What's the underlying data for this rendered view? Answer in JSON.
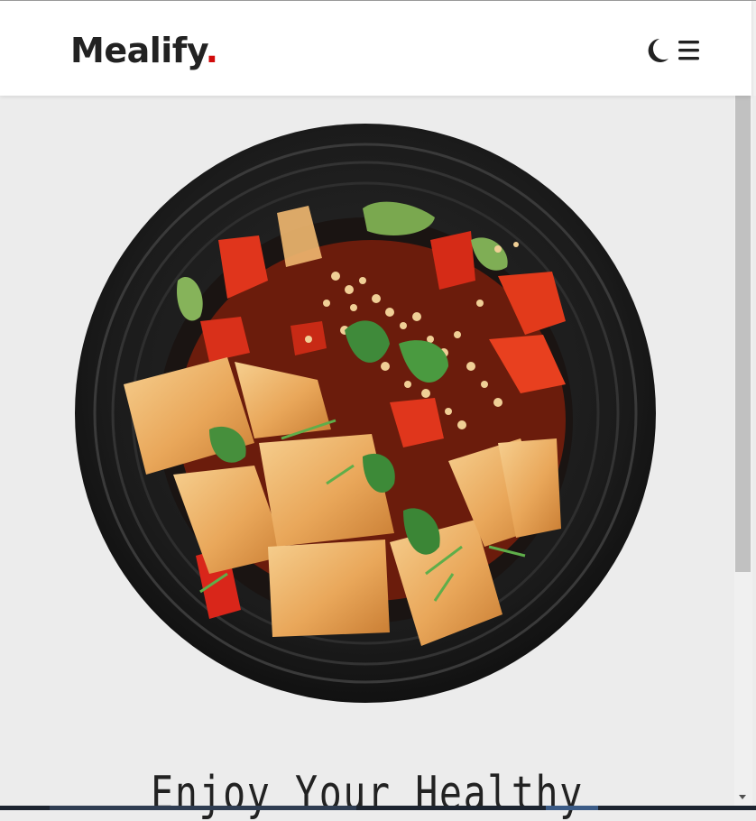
{
  "header": {
    "brand": "Mealify",
    "brand_dot": ".",
    "theme_toggle_icon": "moon-icon",
    "menu_icon": "hamburger-menu-icon"
  },
  "hero": {
    "image": "tofu-stir-fry-bowl",
    "headline": "Enjoy Your Healthy"
  },
  "colors": {
    "accent": "#d10b0b",
    "text": "#222222",
    "background": "#ececec",
    "header_bg": "#ffffff"
  }
}
